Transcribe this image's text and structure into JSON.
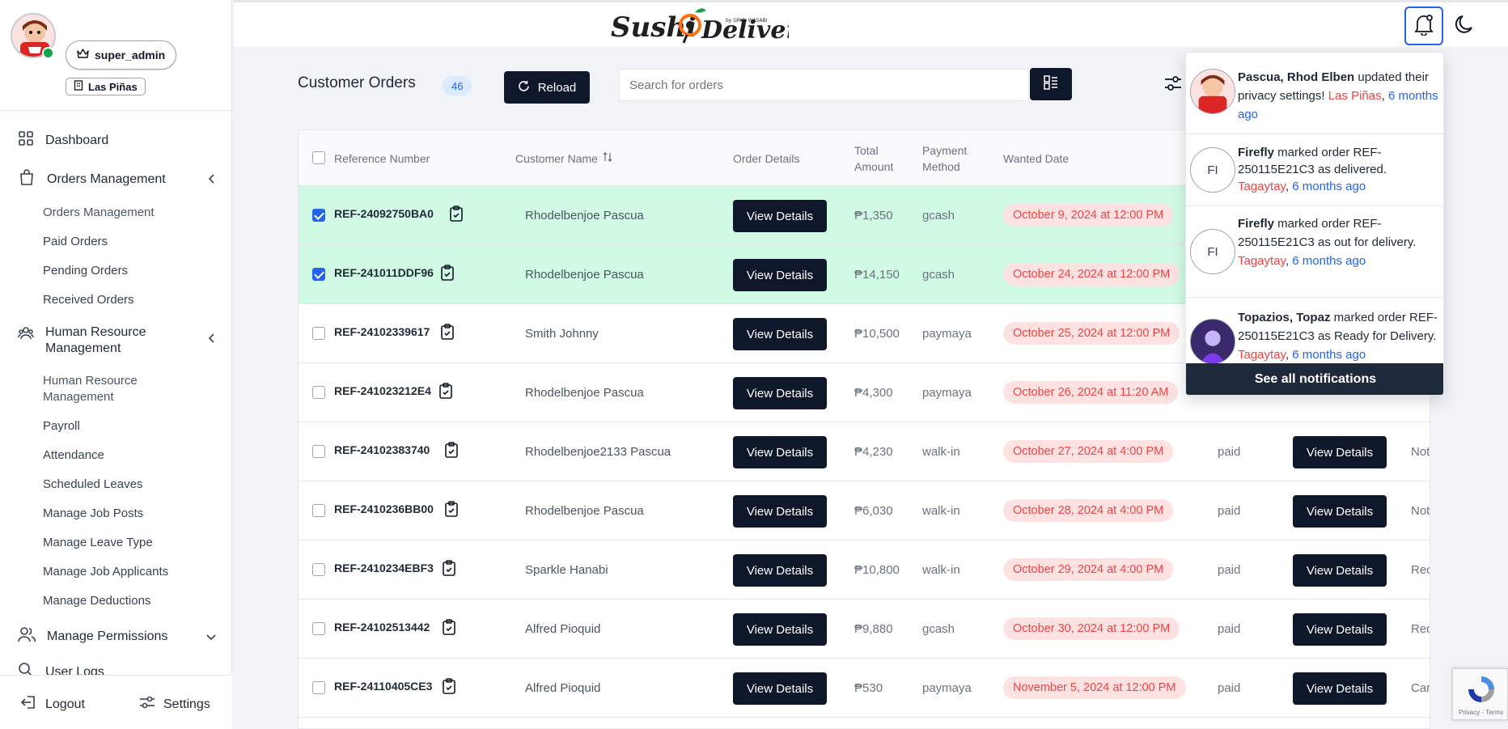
{
  "user": {
    "role": "super_admin",
    "branch": "Las Piñas"
  },
  "sidebar": {
    "dashboard": "Dashboard",
    "orders_management": "Orders Management",
    "orders_sub": [
      "Orders Management",
      "Paid Orders",
      "Pending Orders",
      "Received Orders"
    ],
    "hr_management": "Human Resource Management",
    "hr_sub": [
      "Human Resource Management",
      "Payroll",
      "Attendance",
      "Scheduled Leaves",
      "Manage Job Posts",
      "Manage Leave Type",
      "Manage Job Applicants",
      "Manage Deductions"
    ],
    "manage_permissions": "Manage Permissions",
    "user_logs": "User Logs",
    "logout": "Logout",
    "settings": "Settings"
  },
  "header": {
    "logo_text": "Sushi Delivery",
    "logo_tag": "by GRYN WASABI"
  },
  "main": {
    "title": "Customer Orders",
    "count": "46",
    "reload_label": "Reload",
    "search_placeholder": "Search for orders"
  },
  "table": {
    "headers": {
      "reference": "Reference Number",
      "customer": "Customer Name",
      "details": "Order Details",
      "amount": "Total Amount",
      "payment": "Payment Method",
      "wanted": "Wanted Date"
    },
    "view_label": "View Details",
    "rows": [
      {
        "ref": "REF-24092750BA0",
        "customer": "Rhodelbenjoe Pascua",
        "amount": "₱1,350",
        "payment": "gcash",
        "wanted": "October 9, 2024 at 12:00 PM",
        "status": "",
        "extra": "",
        "selected": true
      },
      {
        "ref": "REF-241011DDF96",
        "customer": "Rhodelbenjoe Pascua",
        "amount": "₱14,150",
        "payment": "gcash",
        "wanted": "October 24, 2024 at 12:00 PM",
        "status": "",
        "extra": "",
        "selected": true
      },
      {
        "ref": "REF-24102339617",
        "customer": "Smith Johnny",
        "amount": "₱10,500",
        "payment": "paymaya",
        "wanted": "October 25, 2024 at 12:00 PM",
        "status": "",
        "extra": "",
        "selected": false
      },
      {
        "ref": "REF-241023212E4",
        "customer": "Rhodelbenjoe Pascua",
        "amount": "₱4,300",
        "payment": "paymaya",
        "wanted": "October 26, 2024 at 11:20 AM",
        "status": "",
        "extra": "",
        "selected": false
      },
      {
        "ref": "REF-24102383740",
        "customer": "Rhodelbenjoe2133 Pascua",
        "amount": "₱4,230",
        "payment": "walk-in",
        "wanted": "October 27, 2024 at 4:00 PM",
        "status": "paid",
        "extra": "Not",
        "selected": false
      },
      {
        "ref": "REF-2410236BB00",
        "customer": "Rhodelbenjoe Pascua",
        "amount": "₱6,030",
        "payment": "walk-in",
        "wanted": "October 28, 2024 at 4:00 PM",
        "status": "paid",
        "extra": "Not",
        "selected": false
      },
      {
        "ref": "REF-2410234EBF3",
        "customer": "Sparkle Hanabi",
        "amount": "₱10,800",
        "payment": "walk-in",
        "wanted": "October 29, 2024 at 4:00 PM",
        "status": "paid",
        "extra": "Rec",
        "selected": false
      },
      {
        "ref": "REF-24102513442",
        "customer": "Alfred Pioquid",
        "amount": "₱9,880",
        "payment": "gcash",
        "wanted": "October 30, 2024 at 12:00 PM",
        "status": "paid",
        "extra": "Rec",
        "selected": false
      },
      {
        "ref": "REF-24110405CE3",
        "customer": "Alfred Pioquid",
        "amount": "₱530",
        "payment": "paymaya",
        "wanted": "November 5, 2024 at 12:00 PM",
        "status": "paid",
        "extra": "Car",
        "selected": false
      }
    ]
  },
  "notifications": {
    "items": [
      {
        "avatar": "",
        "actor": "Pascua, Rhod Elben",
        "text": " updated their privacy settings! ",
        "branch": "Las Piñas",
        "time": "6 months ago"
      },
      {
        "avatar": "FI",
        "actor": "Firefly",
        "text": " marked order REF-250115E21C3 as delivered. ",
        "branch": "Tagaytay",
        "time": "6 months ago"
      },
      {
        "avatar": "FI",
        "actor": "Firefly",
        "text": " marked order REF-250115E21C3 as out for delivery. ",
        "branch": "Tagaytay",
        "time": "6 months ago"
      },
      {
        "avatar": "",
        "actor": "Topazios, Topaz",
        "text": " marked order REF-250115E21C3 as Ready for Delivery. ",
        "branch": "Tagaytay",
        "time": "6 months ago"
      }
    ],
    "see_all": "See all notifications"
  },
  "recaptcha": {
    "text": "Privacy - Terms"
  },
  "colors": {
    "primary_dark": "#0f172a",
    "selected_row": "#d1fae5",
    "date_bg": "#fee2e2",
    "date_text": "#ef4444",
    "link_blue": "#2563eb"
  }
}
